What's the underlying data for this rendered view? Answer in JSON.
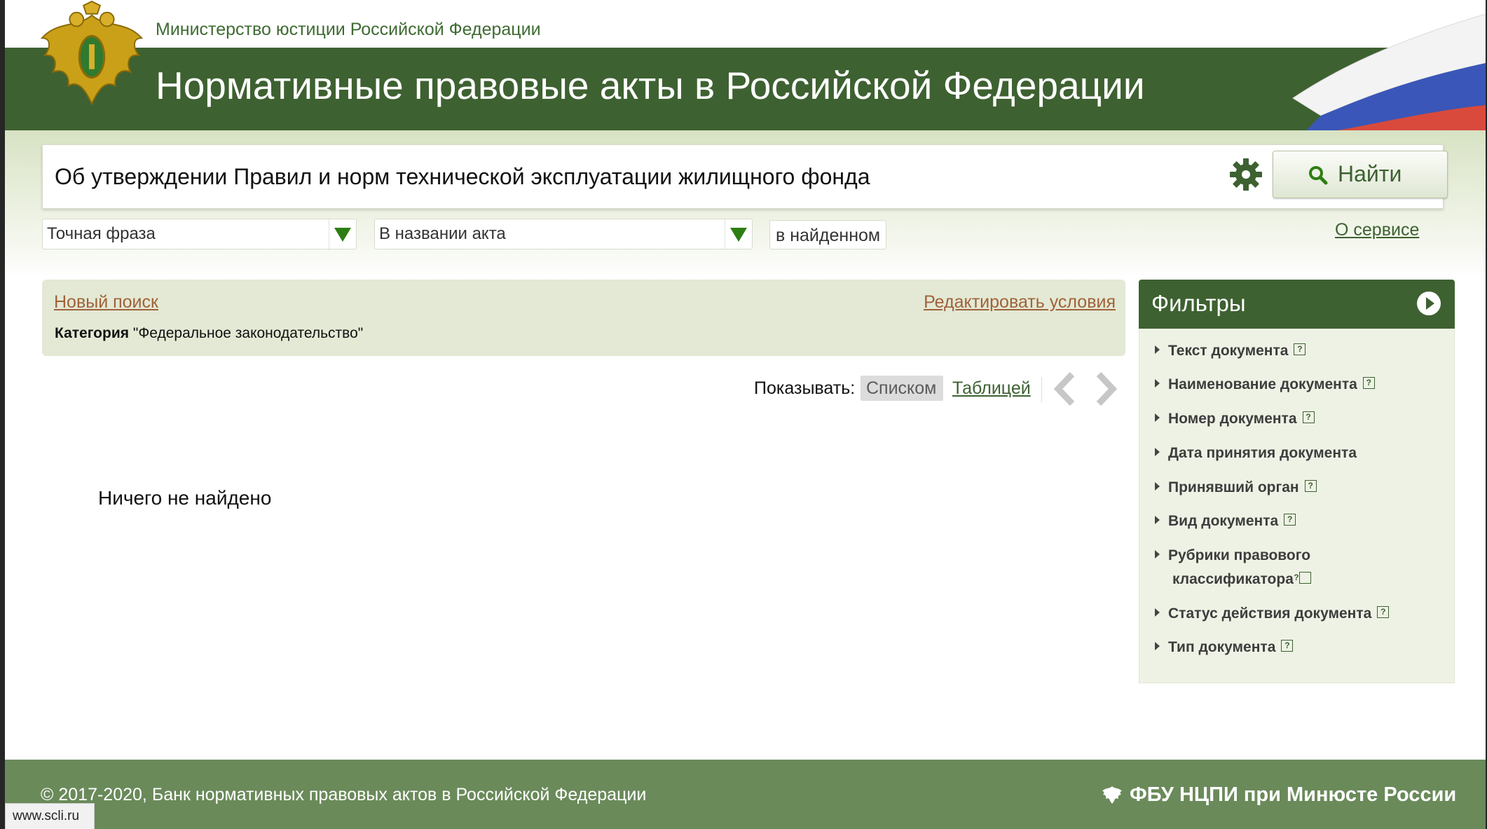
{
  "header": {
    "ministry": "Министерство юстиции Российской Федерации",
    "title": "Нормативные правовые акты в Российской Федерации",
    "emblem_icon": "double-headed-eagle-emblem",
    "flag_icon": "russian-flag"
  },
  "search": {
    "query": "Об утверждении Правил и норм технической эксплуатации жилищного фонда",
    "settings_icon": "gear-icon",
    "find_label": "Найти",
    "mode_select": "Точная фраза",
    "scope_select": "В названии акта",
    "in_found_label": "в найденном",
    "about_link": "О сервисе"
  },
  "conditions": {
    "new_search": "Новый поиск",
    "edit": "Редактировать условия",
    "category_label": "Категория",
    "category_value": "\"Федеральное законодательство\""
  },
  "view": {
    "show_label": "Показывать:",
    "list_label": "Списком",
    "table_label": "Таблицей"
  },
  "results": {
    "empty_message": "Ничего не найдено"
  },
  "filters": {
    "title": "Фильтры",
    "items": [
      {
        "label": "Текст документа",
        "help": true
      },
      {
        "label": "Наименование документа",
        "help": true
      },
      {
        "label": "Номер документа",
        "help": true
      },
      {
        "label": "Дата принятия документа",
        "help": false
      },
      {
        "label": "Принявший орган",
        "help": true
      },
      {
        "label": "Вид документа",
        "help": true
      },
      {
        "label": "Рубрики правового классификатора",
        "help": true
      },
      {
        "label": "Статус действия документа",
        "help": true
      },
      {
        "label": "Тип документа",
        "help": true
      }
    ]
  },
  "footer": {
    "copyright": "© 2017-2020, Банк нормативных правовых актов в Российской Федерации",
    "org": "ФБУ НЦПИ при Минюсте России"
  },
  "watermark": "www.scli.ru",
  "colors": {
    "brand_green": "#3e6131",
    "footer_green": "#6a8a5a",
    "link_brown": "#a0623a",
    "panel_bg": "#e3e9d4"
  }
}
